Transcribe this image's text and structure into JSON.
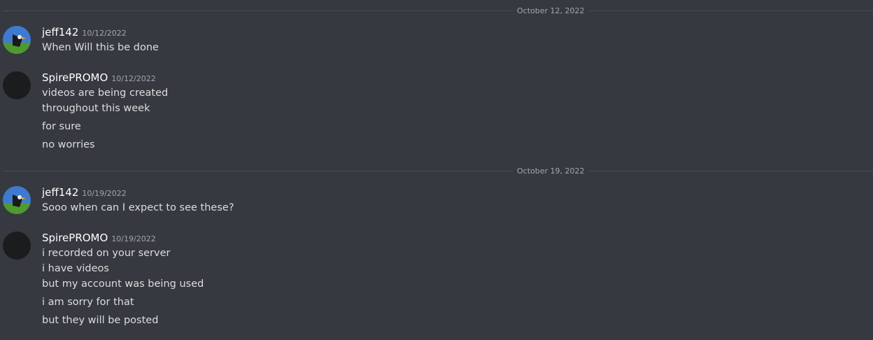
{
  "dates": [
    "October 12, 2022",
    "October 19, 2022"
  ],
  "groups": [
    {
      "username": "jeff142",
      "timestamp": "10/12/2022",
      "avatar": "bird-avatar",
      "lines": [
        "When Will this be done"
      ]
    },
    {
      "username": "SpirePROMO",
      "timestamp": "10/12/2022",
      "avatar": "dark-avatar",
      "lines": [
        "videos are being created",
        "throughout this week",
        "for sure",
        "no worries"
      ]
    },
    {
      "username": "jeff142",
      "timestamp": "10/19/2022",
      "avatar": "bird-avatar",
      "lines": [
        "Sooo when can I expect to see these?"
      ]
    },
    {
      "username": "SpirePROMO",
      "timestamp": "10/19/2022",
      "avatar": "dark-avatar",
      "lines": [
        "i recorded on your server",
        "i have videos",
        "but my account was being used",
        "i am sorry for that",
        "but they will be posted"
      ]
    }
  ],
  "colors": {
    "background": "#36393f",
    "username": "#ffffff",
    "message_text": "#dcddde",
    "muted_text": "#a3a6aa",
    "divider": "#4a4d53"
  }
}
